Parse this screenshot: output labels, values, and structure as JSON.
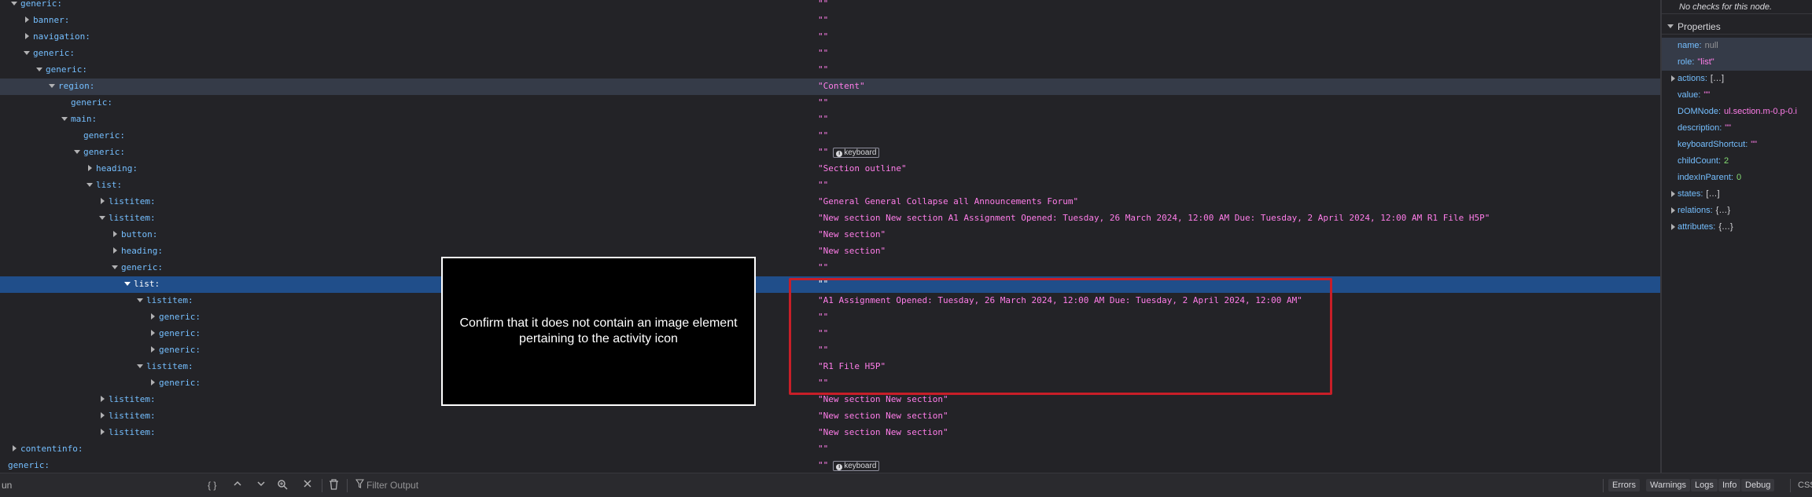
{
  "tree": {
    "rows": [
      {
        "role": "generic:",
        "name": "\"\"",
        "state": "open"
      },
      {
        "role": "banner:",
        "name": "\"\"",
        "state": "closed"
      },
      {
        "role": "navigation:",
        "name": "\"\"",
        "state": "closed"
      },
      {
        "role": "generic:",
        "name": "\"\"",
        "state": "open"
      },
      {
        "role": "generic:",
        "name": "\"\"",
        "state": "open"
      },
      {
        "role": "region:",
        "name": "\"Content\"",
        "state": "open"
      },
      {
        "role": "generic:",
        "name": "\"\"",
        "state": "none"
      },
      {
        "role": "main:",
        "name": "\"\"",
        "state": "open"
      },
      {
        "role": "generic:",
        "name": "\"\"",
        "state": "none"
      },
      {
        "role": "generic:",
        "name": "\"\"",
        "state": "open",
        "badge": "keyboard"
      },
      {
        "role": "heading:",
        "name": "\"Section outline\"",
        "state": "closed"
      },
      {
        "role": "list:",
        "name": "\"\"",
        "state": "open"
      },
      {
        "role": "listitem:",
        "name": "\"General General Collapse all Announcements Forum\"",
        "state": "closed"
      },
      {
        "role": "listitem:",
        "name": "\"New section New section A1 Assignment Opened: Tuesday, 26 March 2024, 12:00 AM Due: Tuesday, 2 April 2024, 12:00 AM R1 File H5P\"",
        "state": "open"
      },
      {
        "role": "button:",
        "name": "\"New section\"",
        "state": "closed"
      },
      {
        "role": "heading:",
        "name": "\"New section\"",
        "state": "closed"
      },
      {
        "role": "generic:",
        "name": "\"\"",
        "state": "open"
      },
      {
        "role": "list:",
        "name": "\"\"",
        "state": "open"
      },
      {
        "role": "listitem:",
        "name": "\"A1 Assignment Opened: Tuesday, 26 March 2024, 12:00 AM Due: Tuesday, 2 April 2024, 12:00 AM\"",
        "state": "open"
      },
      {
        "role": "generic:",
        "name": "\"\"",
        "state": "closed"
      },
      {
        "role": "generic:",
        "name": "\"\"",
        "state": "closed"
      },
      {
        "role": "generic:",
        "name": "\"\"",
        "state": "closed"
      },
      {
        "role": "listitem:",
        "name": "\"R1 File H5P\"",
        "state": "open"
      },
      {
        "role": "generic:",
        "name": "\"\"",
        "state": "closed"
      },
      {
        "role": "listitem:",
        "name": "\"New section New section\"",
        "state": "closed"
      },
      {
        "role": "listitem:",
        "name": "\"New section New section\"",
        "state": "closed"
      },
      {
        "role": "listitem:",
        "name": "\"New section New section\"",
        "state": "closed"
      },
      {
        "role": "contentinfo:",
        "name": "\"\"",
        "state": "closed"
      },
      {
        "role": "generic:",
        "name": "\"\"",
        "state": "none",
        "badge": "keyboard"
      }
    ],
    "badge_label": "keyboard"
  },
  "sidebar": {
    "checks_text": "No checks for this node.",
    "properties_title": "Properties",
    "props": [
      {
        "key": "name:",
        "value": "null",
        "kind": "nul"
      },
      {
        "key": "role:",
        "value": "\"list\"",
        "kind": "str"
      },
      {
        "key": "actions:",
        "value": "[…]",
        "kind": "obj",
        "expandable": true
      },
      {
        "key": "value:",
        "value": "\"\"",
        "kind": "str"
      },
      {
        "key": "DOMNode:",
        "value": "ul.section.m-0.p-0.i",
        "kind": "str"
      },
      {
        "key": "description:",
        "value": "\"\"",
        "kind": "str"
      },
      {
        "key": "keyboardShortcut:",
        "value": "\"\"",
        "kind": "str"
      },
      {
        "key": "childCount:",
        "value": "2",
        "kind": "num"
      },
      {
        "key": "indexInParent:",
        "value": "0",
        "kind": "num"
      },
      {
        "key": "states:",
        "value": "[…]",
        "kind": "obj",
        "expandable": true
      },
      {
        "key": "relations:",
        "value": "{…}",
        "kind": "obj",
        "expandable": true
      },
      {
        "key": "attributes:",
        "value": "{…}",
        "kind": "obj",
        "expandable": true
      }
    ]
  },
  "toolbar": {
    "left_text": "un",
    "braces": "{ }",
    "filter_placeholder": "Filter Output",
    "buttons": [
      "Errors",
      "Warnings",
      "Logs",
      "Info",
      "Debug"
    ],
    "css_label": "CSS"
  },
  "overlay": {
    "text": "Confirm that it does not contain an image element pertaining to the activity icon"
  }
}
